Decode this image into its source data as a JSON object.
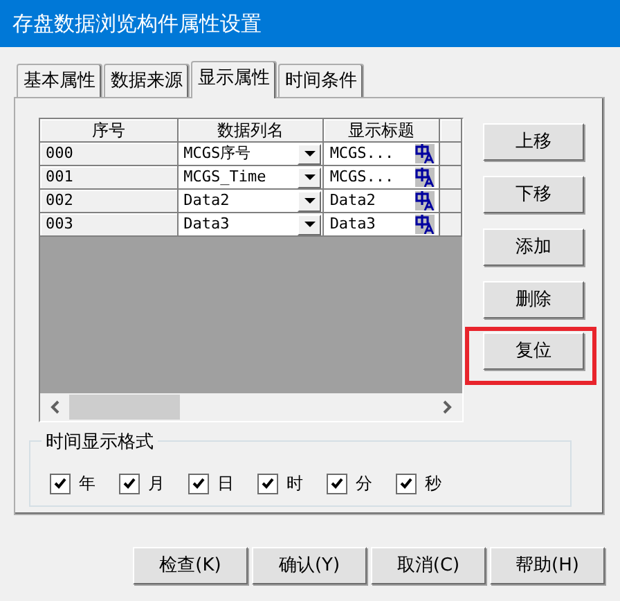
{
  "window": {
    "title": "存盘数据浏览构件属性设置"
  },
  "tabs": [
    {
      "label": "基本属性",
      "selected": false
    },
    {
      "label": "数据来源",
      "selected": false
    },
    {
      "label": "显示属性",
      "selected": true
    },
    {
      "label": "时间条件",
      "selected": false
    }
  ],
  "table": {
    "columns": [
      "序号",
      "数据列名",
      "显示标题"
    ],
    "rows": [
      {
        "index": "000",
        "column_name": "MCGS序号",
        "title": "MCGS..."
      },
      {
        "index": "001",
        "column_name": "MCGS_Time",
        "title": "MCGS..."
      },
      {
        "index": "002",
        "column_name": "Data2",
        "title": "Data2"
      },
      {
        "index": "003",
        "column_name": "Data3",
        "title": "Data3"
      }
    ]
  },
  "side_buttons": [
    {
      "label": "上移",
      "highlighted": false
    },
    {
      "label": "下移",
      "highlighted": false
    },
    {
      "label": "添加",
      "highlighted": false
    },
    {
      "label": "删除",
      "highlighted": false
    },
    {
      "label": "复位",
      "highlighted": true
    }
  ],
  "time_format": {
    "title": "时间显示格式",
    "options": [
      {
        "label": "年",
        "checked": true
      },
      {
        "label": "月",
        "checked": true
      },
      {
        "label": "日",
        "checked": true
      },
      {
        "label": "时",
        "checked": true
      },
      {
        "label": "分",
        "checked": true
      },
      {
        "label": "秒",
        "checked": true
      }
    ]
  },
  "buttons": [
    "检查(K)",
    "确认(Y)",
    "取消(C)",
    "帮助(H)"
  ]
}
